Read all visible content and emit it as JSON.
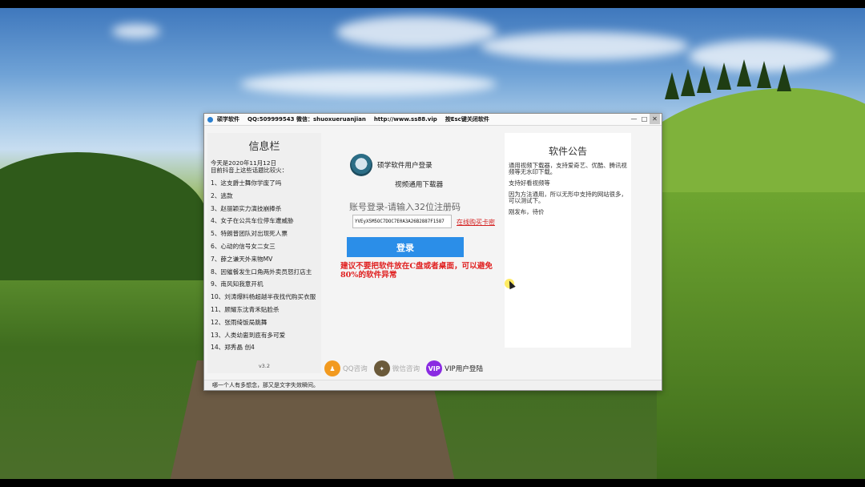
{
  "window": {
    "title_parts": [
      "硕学软件",
      "QQ:509999543 微信：shuoxueruanjian",
      "http://www.ss88.vip",
      "按Esc键关闭软件"
    ],
    "controls": [
      "—",
      "□",
      "✕"
    ]
  },
  "info_panel": {
    "title": "信息栏",
    "date_line1": "今天是2020年11月12日",
    "date_line2": "目前抖音上这些话题比较火：",
    "items": [
      "1、这支爵士舞你学废了吗",
      "2、逃款",
      "3、赵丽颖实力演技崩捧杀",
      "4、女子在公共车位停车遭威胁",
      "5、特朗普团队对出现死人票",
      "6、心动的信号女二女三",
      "7、薛之谦天外来物MV",
      "8、因催餐发生口角两外卖员怒打店主",
      "9、南风知我意开机",
      "10、刘涛爆料杨超越半夜找代购买衣服",
      "11、顾耀东沈青禾贴脸杀",
      "12、张雨绮饭局跳舞",
      "13、人类幼崽到底有多可爱",
      "14、郑秀晶 创4"
    ],
    "version": "v3.2"
  },
  "login": {
    "title": "硕学软件用户登录",
    "subtitle": "视频通用下载器",
    "account_label": "账号登录-请输入32位注册码",
    "code_value": "YVEyX5M5OC7DOC7E0A3A26B2887F1587",
    "buy_link": "在线购买卡密",
    "login_button": "登录",
    "warning": "建议不要把软件放在C盘或者桌面，可以避免80%的软件异常"
  },
  "notice": {
    "title": "软件公告",
    "p1": "通用视频下载器，支持爱奇艺、优酷、腾讯视频等无水印下载。",
    "p2": "支持好看视频等",
    "p3": "因为方法通用，所以无形中支持的网站很多，可以测试下。",
    "p4": "刚发布，待价"
  },
  "bottom": {
    "qq_label": "QQ咨询",
    "wechat_label": "微信咨询",
    "vip_badge": "VIP",
    "vip_label": "VIP用户登陆"
  },
  "status": {
    "text": "哪一个人有多想念，那又是文字失效瞬间。"
  }
}
